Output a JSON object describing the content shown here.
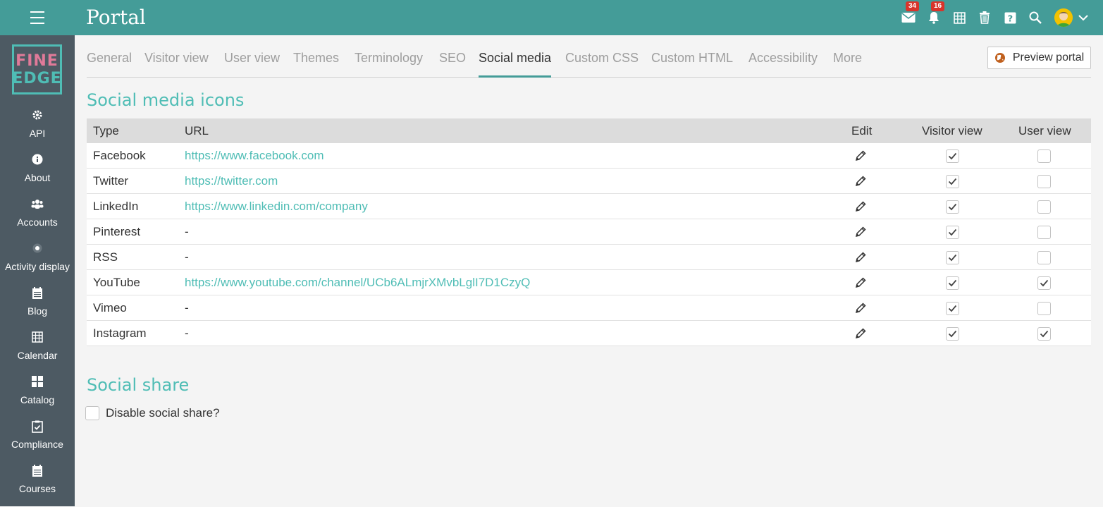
{
  "app": {
    "title": "Portal"
  },
  "logo": {
    "line1": "FINE",
    "line2": "EDGE"
  },
  "sidebar": {
    "items": [
      {
        "label": "API",
        "icon": "gear-icon"
      },
      {
        "label": "About",
        "icon": "info-icon"
      },
      {
        "label": "Accounts",
        "icon": "users-icon"
      },
      {
        "label": "Activity display",
        "icon": "radio-dot-icon"
      },
      {
        "label": "Blog",
        "icon": "blog-icon"
      },
      {
        "label": "Calendar",
        "icon": "calendar-icon"
      },
      {
        "label": "Catalog",
        "icon": "grid-icon"
      },
      {
        "label": "Compliance",
        "icon": "checklist-icon"
      },
      {
        "label": "Courses",
        "icon": "courses-icon"
      }
    ]
  },
  "topbar": {
    "messages_badge": "34",
    "notifications_badge": "16"
  },
  "tabs": [
    {
      "label": "General"
    },
    {
      "label": "Visitor view"
    },
    {
      "label": "User view"
    },
    {
      "label": "Themes"
    },
    {
      "label": "Terminology"
    },
    {
      "label": "SEO"
    },
    {
      "label": "Social media",
      "active": true
    },
    {
      "label": "Custom CSS"
    },
    {
      "label": "Custom HTML"
    },
    {
      "label": "Accessibility"
    },
    {
      "label": "More"
    }
  ],
  "preview_button": {
    "label": "Preview portal"
  },
  "social_icons": {
    "title": "Social media icons",
    "columns": {
      "type": "Type",
      "url": "URL",
      "edit": "Edit",
      "visitor": "Visitor view",
      "user": "User view"
    },
    "rows": [
      {
        "type": "Facebook",
        "url": "https://www.facebook.com",
        "has_url": true,
        "visitor": true,
        "user": false
      },
      {
        "type": "Twitter",
        "url": "https://twitter.com",
        "has_url": true,
        "visitor": true,
        "user": false
      },
      {
        "type": "LinkedIn",
        "url": "https://www.linkedin.com/company",
        "has_url": true,
        "visitor": true,
        "user": false
      },
      {
        "type": "Pinterest",
        "url": "-",
        "has_url": false,
        "visitor": true,
        "user": false
      },
      {
        "type": "RSS",
        "url": "-",
        "has_url": false,
        "visitor": true,
        "user": false
      },
      {
        "type": "YouTube",
        "url": "https://www.youtube.com/channel/UCb6ALmjrXMvbLglI7D1CzyQ",
        "has_url": true,
        "visitor": true,
        "user": true
      },
      {
        "type": "Vimeo",
        "url": "-",
        "has_url": false,
        "visitor": true,
        "user": false
      },
      {
        "type": "Instagram",
        "url": "-",
        "has_url": false,
        "visitor": true,
        "user": true
      }
    ]
  },
  "social_share": {
    "title": "Social share",
    "checkbox_label": "Disable social share?",
    "checked": false
  },
  "colors": {
    "accent": "#449c98",
    "link": "#4fbdb5",
    "sidebar": "#4d5a63",
    "badge": "#d9342b"
  }
}
